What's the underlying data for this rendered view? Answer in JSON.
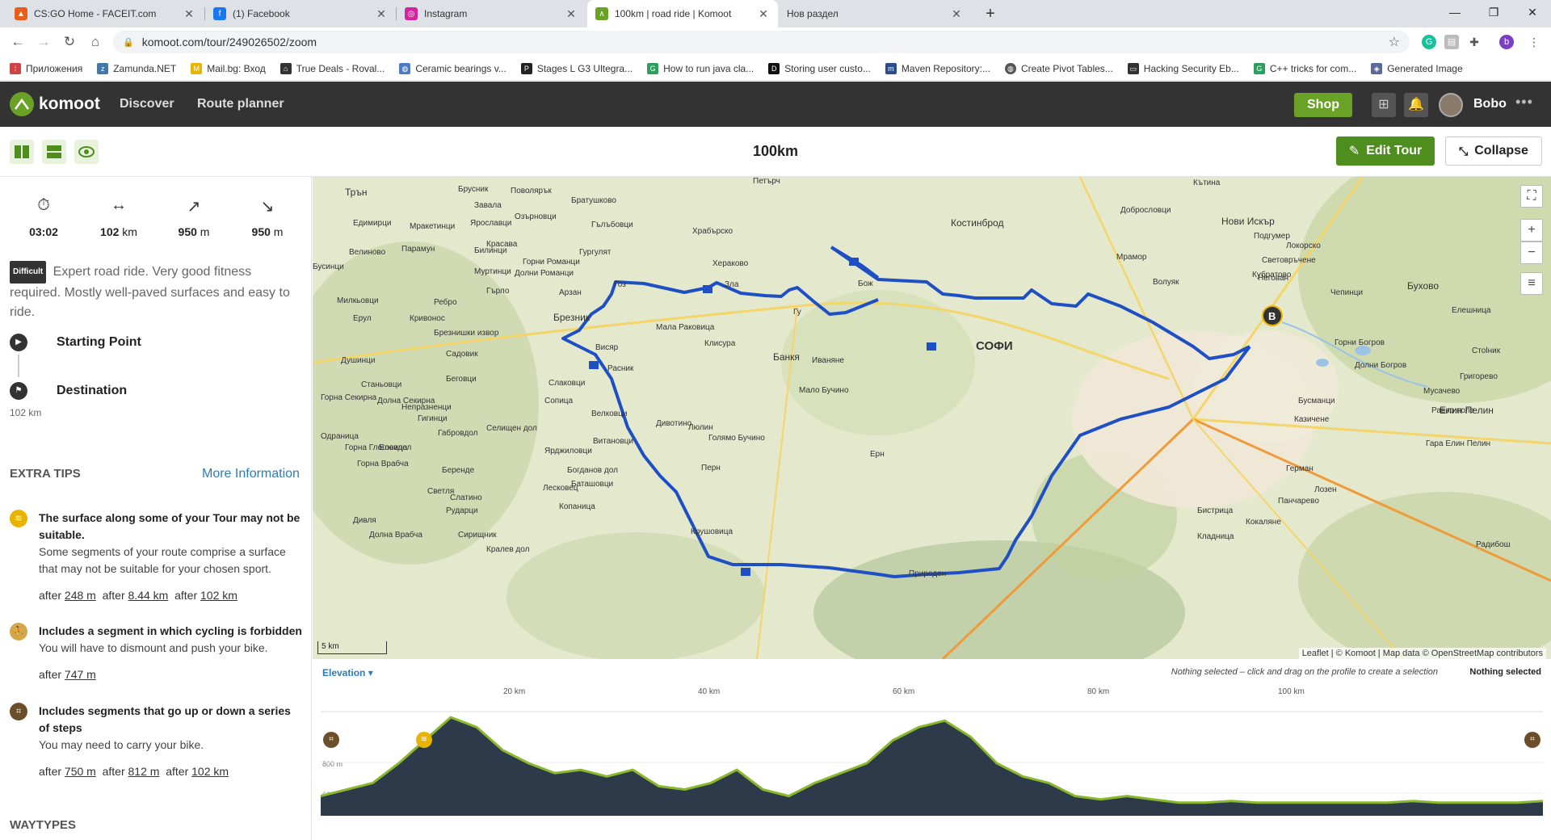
{
  "browser": {
    "tabs": [
      {
        "label": "CS:GO Home - FACEIT.com",
        "icon": "faceit-icon"
      },
      {
        "label": "(1) Facebook",
        "icon": "facebook-icon"
      },
      {
        "label": "Instagram",
        "icon": "instagram-icon"
      },
      {
        "label": "100km | road ride | Komoot",
        "icon": "komoot-icon",
        "active": true
      },
      {
        "label": "Нов раздел",
        "icon": "none"
      }
    ],
    "url": "komoot.com/tour/249026502/zoom",
    "profile_initial": "b",
    "bookmarks": [
      "Приложения",
      "Zamunda.NET",
      "Mail.bg: Вход",
      "True Deals - Roval...",
      "Ceramic bearings v...",
      "Stages L G3 Ultegra...",
      "How to run java cla...",
      "Storing user custo...",
      "Maven Repository:...",
      "Create Pivot Tables...",
      "Hacking Security Eb...",
      "C++ tricks for com...",
      "Generated Image"
    ]
  },
  "header": {
    "logo": "komoot",
    "nav": [
      "Discover",
      "Route planner"
    ],
    "shop": "Shop",
    "user": "Bobo",
    "brand_color": "#6aa127"
  },
  "toolbar": {
    "title": "100km",
    "edit": "Edit Tour",
    "collapse": "Collapse"
  },
  "stats": [
    {
      "icon": "stopwatch-icon",
      "value": "03:02",
      "unit": ""
    },
    {
      "icon": "distance-icon",
      "value": "102",
      "unit": "km"
    },
    {
      "icon": "uphill-icon",
      "value": "950",
      "unit": "m"
    },
    {
      "icon": "downhill-icon",
      "value": "950",
      "unit": "m"
    }
  ],
  "difficulty": {
    "badge": "Difficult",
    "text": "Expert road ride. Very good fitness required. Mostly well-paved surfaces and easy to ride."
  },
  "waypoints": {
    "start": "Starting Point",
    "end": "Destination",
    "distance": "102 km"
  },
  "tips": {
    "heading": "EXTRA TIPS",
    "more": "More Information",
    "items": [
      {
        "title": "The surface along some of your Tour may not be suitable.",
        "desc": "Some segments of your route comprise a surface that may not be suitable for your chosen sport.",
        "after": [
          "248 m",
          "8.44 km",
          "102 km"
        ]
      },
      {
        "title": "Includes a segment in which cycling is forbidden",
        "desc": "You will have to dismount and push your bike.",
        "after": [
          "747 m"
        ]
      },
      {
        "title": "Includes segments that go up or down a series of steps",
        "desc": "You may need to carry your bike.",
        "after": [
          "750 m",
          "812 m",
          "102 km"
        ]
      }
    ],
    "after_word": "after"
  },
  "waytypes": "WAYTYPES",
  "map": {
    "scale": "5 km",
    "attribution": "Leaflet | © Komoot | Map data © OpenStreetMap contributors",
    "route_color": "#1f4fc4",
    "labels": [
      "Трън",
      "Брусник",
      "Поволярък",
      "Петърч",
      "Кътина",
      "Завала",
      "Братушково",
      "Добрословци",
      "Нови Искър",
      "Костинброд",
      "Ярославци",
      "Озърновци",
      "Гълъбовци",
      "Подгумер",
      "Едимирци",
      "Мракетинци",
      "Хрaбърско",
      "Локорско",
      "Красава",
      "Мрамор",
      "Световръчене",
      "Велиново",
      "Парамун",
      "Билинци",
      "Гургулят",
      "Горни Романци",
      "Хераково",
      "Кубратово",
      "Бусинци",
      "Муртинци",
      "Долни Романци",
      "Негован",
      "Бухово",
      "Ерул",
      "Ребро",
      "Гърло",
      "Арзан",
      "Волуяк",
      "Чепинци",
      "Милкьовци",
      "Кривонос",
      "Брезник",
      "Елешница",
      "Горни Богров",
      "Мала Раковица",
      "Клисура",
      "Банкя",
      "Брезнишки извор",
      "Висяр",
      "Стolник",
      "Душинци",
      "Садовик",
      "Иваняне",
      "Долни Богров",
      "Беговци",
      "Расник",
      "Мало Бучино",
      "Григорево",
      "Станьовци",
      "Слаковци",
      "Горна Секирна",
      "Долна Секирна",
      "Бусманци",
      "Мусачево",
      "Непразненци",
      "Сопица",
      "Равно поле",
      "Елин Пелин",
      "Гигинци",
      "Велковци",
      "Казичене",
      "Селищен дол",
      "Дивотино",
      "Люлин",
      "Гара Елин Пелин",
      "Одраница",
      "Габровдол",
      "Витановци",
      "Голямо Бучино",
      "Ярджиловци",
      "Горна Глоговица",
      "Еловдол",
      "Богданов дол",
      "Герман",
      "Беренде",
      "Горна Врабча",
      "Баташовци",
      "Лозен",
      "Светля",
      "Слатино",
      "Лесковец",
      "Панчарево",
      "Рударци",
      "Бистрица",
      "Дивля",
      "Копаница",
      "Кокаляне",
      "Долна Врабча",
      "Сирищник",
      "Кладница",
      "Кралев дол",
      "Радибош",
      "Крушовица",
      "Природен",
      "Гоз",
      "Злa",
      "Гу",
      "Бож",
      "Перн",
      "Ерн",
      "СОФИ"
    ]
  },
  "elevation": {
    "label": "Elevation",
    "hint": "Nothing selected – click and drag on the profile to create a selection",
    "selected": "Nothing selected",
    "km_ticks": [
      "20 km",
      "40 km",
      "60 km",
      "80 km",
      "100 km"
    ],
    "y_labels": [
      "800 m",
      "600 m"
    ],
    "profile_m": [
      620,
      640,
      660,
      720,
      790,
      860,
      830,
      760,
      720,
      690,
      700,
      680,
      700,
      650,
      640,
      660,
      700,
      640,
      620,
      660,
      690,
      720,
      790,
      830,
      850,
      800,
      720,
      680,
      660,
      620,
      610,
      620,
      610,
      600,
      600,
      605,
      600,
      600,
      600,
      600,
      600,
      600,
      605,
      600,
      600,
      600,
      600,
      605
    ],
    "fill_color": "#2d3a4a",
    "line_color": "#8ab82c"
  }
}
